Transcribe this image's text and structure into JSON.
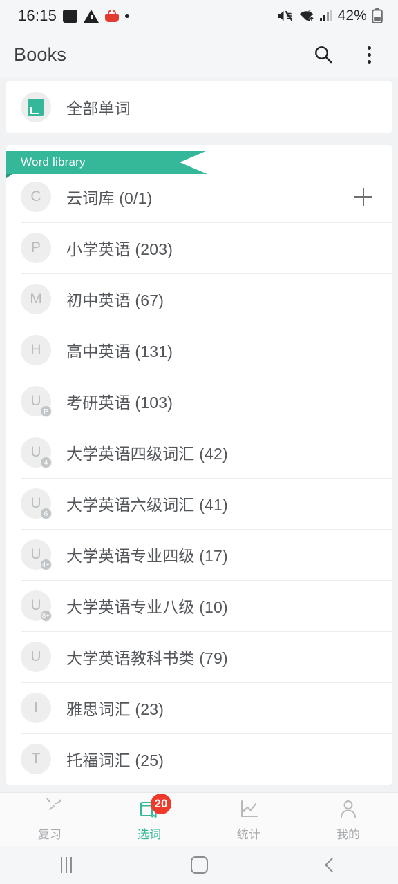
{
  "statusbar": {
    "time": "16:15",
    "battery_percent": "42%",
    "left_icons": [
      "image-icon",
      "warning-icon",
      "shopping-basket-icon",
      "dot-indicator"
    ],
    "right_icons": [
      "mute-icon",
      "wifi-icon",
      "cellular-signal-icon",
      "battery-icon"
    ]
  },
  "toolbar": {
    "title": "Books",
    "search_icon": "search-icon",
    "overflow_icon": "more-vertical-icon"
  },
  "top_card": {
    "icon": "book-icon",
    "label": "全部单词"
  },
  "ribbon": {
    "label": "Word library"
  },
  "library": {
    "items": [
      {
        "initial": "C",
        "badge": "",
        "label": "云词库 (0/1)",
        "action": "add-icon"
      },
      {
        "initial": "P",
        "badge": "",
        "label": "小学英语 (203)",
        "action": ""
      },
      {
        "initial": "M",
        "badge": "",
        "label": "初中英语 (67)",
        "action": ""
      },
      {
        "initial": "H",
        "badge": "",
        "label": "高中英语 (131)",
        "action": ""
      },
      {
        "initial": "U",
        "badge": "P",
        "label": "考研英语 (103)",
        "action": ""
      },
      {
        "initial": "U",
        "badge": "4",
        "label": "大学英语四级词汇 (42)",
        "action": ""
      },
      {
        "initial": "U",
        "badge": "6",
        "label": "大学英语六级词汇 (41)",
        "action": ""
      },
      {
        "initial": "U",
        "badge": "4+",
        "label": "大学英语专业四级 (17)",
        "action": ""
      },
      {
        "initial": "U",
        "badge": "8+",
        "label": "大学英语专业八级 (10)",
        "action": ""
      },
      {
        "initial": "U",
        "badge": "",
        "label": "大学英语教科书类 (79)",
        "action": ""
      },
      {
        "initial": "I",
        "badge": "",
        "label": "雅思词汇 (23)",
        "action": ""
      },
      {
        "initial": "T",
        "badge": "",
        "label": "托福词汇 (25)",
        "action": ""
      }
    ]
  },
  "bottom_nav": {
    "items": [
      {
        "label": "复习",
        "icon": "clock-icon",
        "badge": "",
        "active": false
      },
      {
        "label": "选词",
        "icon": "books-icon",
        "badge": "20",
        "active": true
      },
      {
        "label": "统计",
        "icon": "chart-icon",
        "badge": "",
        "active": false
      },
      {
        "label": "我的",
        "icon": "person-icon",
        "badge": "",
        "active": false
      }
    ]
  },
  "system_nav": {
    "recent_label": "recent-apps-icon",
    "home_label": "home-icon",
    "back_label": "back-icon"
  },
  "colors": {
    "accent": "#35b79a",
    "badge_red": "#f0392b",
    "text_primary": "#53565a",
    "background": "#f1f2f3"
  }
}
